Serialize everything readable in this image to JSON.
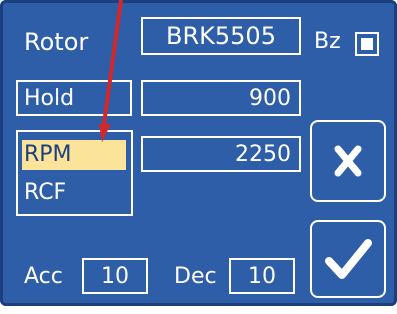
{
  "rotor": {
    "label": "Rotor",
    "value": "BRK5505"
  },
  "bz": {
    "label": "Bz",
    "checked": true
  },
  "hold": {
    "label": "Hold",
    "value": "900"
  },
  "speed_mode": {
    "options": [
      "RPM",
      "RCF"
    ],
    "selected": "RPM",
    "value": "2250"
  },
  "acc": {
    "label": "Acc",
    "value": "10"
  },
  "dec": {
    "label": "Dec",
    "value": "10"
  },
  "buttons": {
    "cancel_icon": "x-icon",
    "confirm_icon": "checkmark-icon"
  },
  "colors": {
    "panel": "#2f5ea8",
    "panel_border": "#1c3f7e",
    "selection": "#fbe39a",
    "annotation_arrow": "#d0282b"
  }
}
